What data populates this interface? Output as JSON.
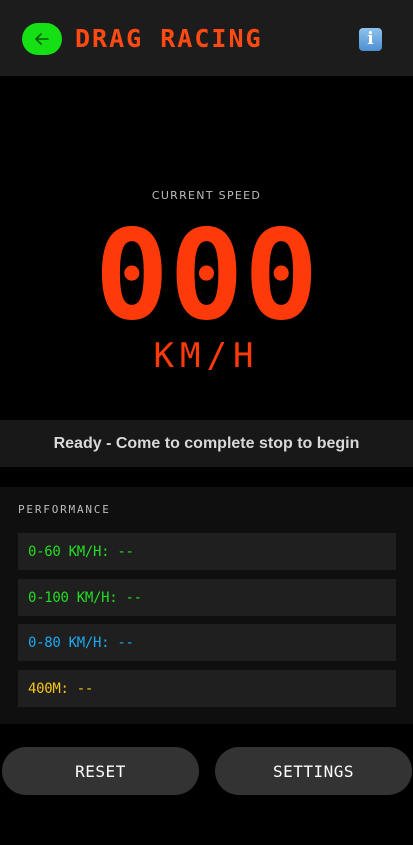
{
  "header": {
    "back_icon": "arrow-left-icon",
    "title": "DRAG RACING",
    "info_icon": "info-icon",
    "colors": {
      "back_button": "#14e014",
      "title": "#ff4a14"
    }
  },
  "speed": {
    "caption": "CURRENT SPEED",
    "value": "000",
    "unit": "KM/H",
    "color": "#ff3a0a"
  },
  "status": {
    "text": "Ready - Come to complete stop to begin"
  },
  "performance": {
    "title": "PERFORMANCE",
    "metrics": [
      {
        "label": "0-60 KM/H: --",
        "color": "#22dd22"
      },
      {
        "label": "0-100 KM/H: --",
        "color": "#22dd22"
      },
      {
        "label": "0-80 KM/H: --",
        "color": "#1fa8f0"
      },
      {
        "label": "400M: --",
        "color": "#f5c518"
      }
    ]
  },
  "buttons": {
    "reset": "RESET",
    "settings": "SETTINGS"
  }
}
